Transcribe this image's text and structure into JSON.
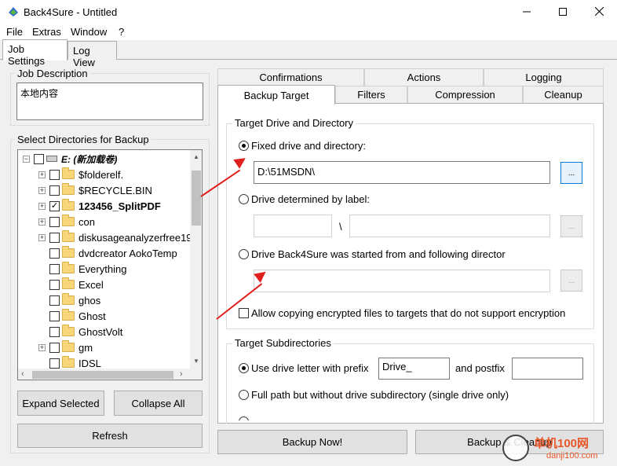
{
  "window": {
    "title": "Back4Sure - Untitled",
    "minimize_icon": "minimize-icon",
    "maximize_icon": "maximize-icon",
    "close_icon": "close-icon"
  },
  "menu": [
    "File",
    "Extras",
    "Window",
    "?"
  ],
  "top_tabs": [
    "Job Settings",
    "Log View"
  ],
  "job_description": {
    "label": "Job Description",
    "value": "本地内容"
  },
  "directories": {
    "label": "Select Directories for Backup",
    "drive_label": "E: (新加载卷)",
    "items": [
      {
        "name": "$folderelf.",
        "expandable": true,
        "checked": false,
        "bold": false
      },
      {
        "name": "$RECYCLE.BIN",
        "expandable": true,
        "checked": false,
        "bold": false
      },
      {
        "name": "123456_SplitPDF",
        "expandable": true,
        "checked": true,
        "bold": true
      },
      {
        "name": "con",
        "expandable": true,
        "checked": false,
        "bold": false
      },
      {
        "name": "diskusageanalyzerfree19",
        "expandable": true,
        "checked": false,
        "bold": false
      },
      {
        "name": "dvdcreator AokoTemp",
        "expandable": false,
        "checked": false,
        "bold": false
      },
      {
        "name": "Everything",
        "expandable": false,
        "checked": false,
        "bold": false
      },
      {
        "name": "Excel",
        "expandable": false,
        "checked": false,
        "bold": false
      },
      {
        "name": "ghos",
        "expandable": false,
        "checked": false,
        "bold": false
      },
      {
        "name": "Ghost",
        "expandable": false,
        "checked": false,
        "bold": false
      },
      {
        "name": "GhostVolt",
        "expandable": false,
        "checked": false,
        "bold": false
      },
      {
        "name": "gm",
        "expandable": true,
        "checked": false,
        "bold": false
      },
      {
        "name": "IDSL",
        "expandable": false,
        "checked": false,
        "bold": false
      }
    ],
    "expand_selected": "Expand Selected",
    "collapse_all": "Collapse All",
    "refresh": "Refresh"
  },
  "right_tabs_row1": [
    "Confirmations",
    "Actions",
    "Logging"
  ],
  "right_tabs_row2": [
    "Backup Target",
    "Filters",
    "Compression",
    "Cleanup"
  ],
  "target": {
    "group_label": "Target Drive and Directory",
    "fixed_label": "Fixed drive and directory:",
    "fixed_value": "D:\\51MSDN\\",
    "browse": "...",
    "by_label": "Drive determined by label:",
    "separator": "\\",
    "started_from": "Drive Back4Sure was started from and following director",
    "allow_encrypted": "Allow copying encrypted files to targets that do not support encryption"
  },
  "subdirs": {
    "group_label": "Target Subdirectories",
    "use_drive_letter": "Use drive letter with prefix",
    "prefix_value": "Drive_",
    "and_postfix": "and postfix",
    "postfix_value": "",
    "full_path": "Full path but without drive subdirectory (single drive only)"
  },
  "bottom_buttons": {
    "backup_now": "Backup Now!",
    "backup_cleanup": "Backup & Cleanup"
  },
  "watermark": {
    "name": "单机100网",
    "url": "danji100.com"
  },
  "colors": {
    "accent": "#0078d7",
    "annotation_arrow": "#e0201d"
  }
}
